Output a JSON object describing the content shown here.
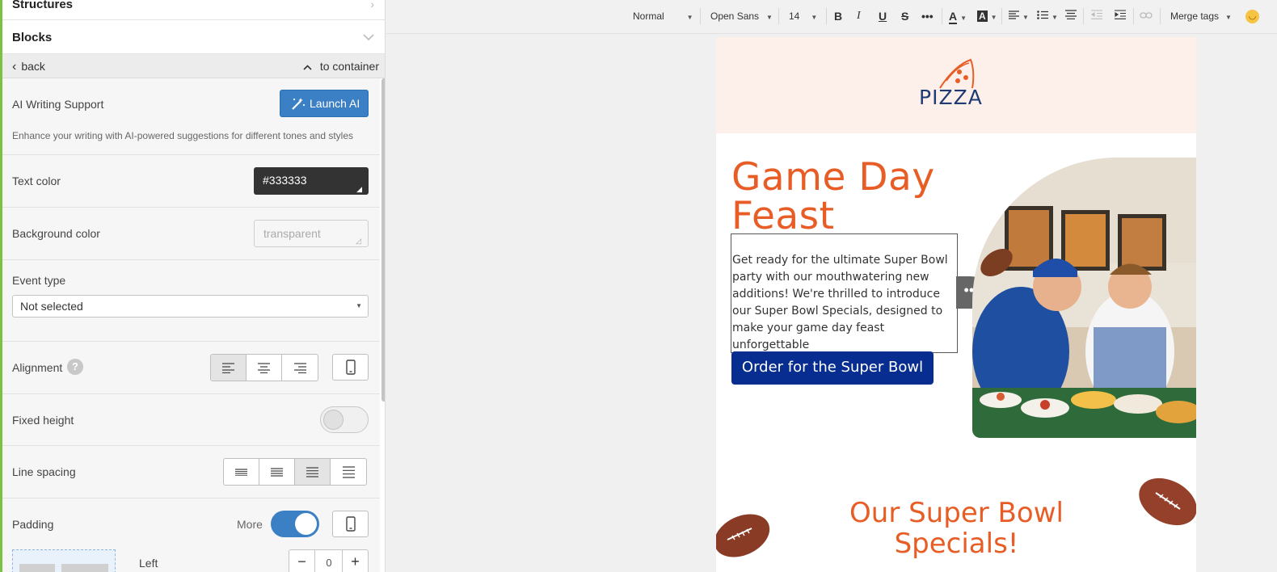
{
  "sidebar": {
    "structures_label": "Structures",
    "blocks_label": "Blocks",
    "back_label": "back",
    "to_container_label": "to container",
    "ai": {
      "label": "AI Writing Support",
      "button": "Launch AI",
      "description": "Enhance your writing with AI-powered suggestions for different tones and styles"
    },
    "text_color": {
      "label": "Text color",
      "value": "#333333"
    },
    "background_color": {
      "label": "Background color",
      "value": "transparent"
    },
    "event_type": {
      "label": "Event type",
      "selected": "Not selected"
    },
    "alignment": {
      "label": "Alignment",
      "active": "left"
    },
    "fixed_height": {
      "label": "Fixed height",
      "on": false
    },
    "line_spacing": {
      "label": "Line spacing",
      "active_index": 2
    },
    "padding": {
      "label": "Padding",
      "more_label": "More",
      "more_on": true,
      "left_label": "Left",
      "left_value": "0"
    }
  },
  "toolbar": {
    "format": "Normal",
    "font": "Open Sans",
    "size": "14",
    "merge_tags": "Merge tags"
  },
  "email": {
    "logo_text": "PIZZA",
    "hero_title": "Game Day Feast",
    "hero_text": "Get ready for the ultimate Super Bowl party with our mouthwatering new additions! We're thrilled to introduce our Super Bowl Specials, designed to make your game day feast unforgettable",
    "cta": "Order for the Super Bowl",
    "specials_title": "Our Super Bowl Specials!"
  },
  "colors": {
    "accent_green": "#7cc242",
    "button_blue": "#3b7fc4",
    "hero_orange": "#e85d26",
    "cta_navy": "#062d8f",
    "header_bg": "#fdf0ea",
    "text_color_box": "#333333"
  }
}
